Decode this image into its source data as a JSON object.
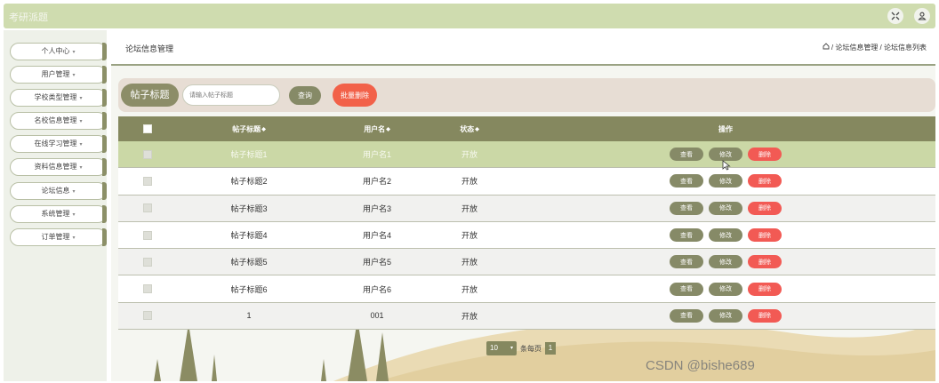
{
  "app": {
    "title": "考研派题",
    "icons": [
      "expand-icon",
      "user-icon"
    ]
  },
  "sidebar": {
    "items": [
      {
        "label": "个人中心"
      },
      {
        "label": "用户管理"
      },
      {
        "label": "学校类型管理"
      },
      {
        "label": "名校信息管理"
      },
      {
        "label": "在线学习管理"
      },
      {
        "label": "资料信息管理"
      },
      {
        "label": "论坛信息"
      },
      {
        "label": "系统管理"
      },
      {
        "label": "订单管理"
      }
    ],
    "arrow": "▾"
  },
  "page": {
    "title": "论坛信息管理",
    "breadcrumb": "/ 论坛信息管理 / 论坛信息列表"
  },
  "search": {
    "label": "帖子标题",
    "placeholder": "请输入帖子标题",
    "value": "",
    "query_btn": "查询",
    "batch_delete_btn": "批量删除"
  },
  "table": {
    "headers": {
      "title": "帖子标题",
      "username": "用户名",
      "status": "状态",
      "ops": "操作",
      "sort": "◆"
    },
    "rows": [
      {
        "title": "帖子标题1",
        "username": "用户名1",
        "status": "开放"
      },
      {
        "title": "帖子标题2",
        "username": "用户名2",
        "status": "开放"
      },
      {
        "title": "帖子标题3",
        "username": "用户名3",
        "status": "开放"
      },
      {
        "title": "帖子标题4",
        "username": "用户名4",
        "status": "开放"
      },
      {
        "title": "帖子标题5",
        "username": "用户名5",
        "status": "开放"
      },
      {
        "title": "帖子标题6",
        "username": "用户名6",
        "status": "开放"
      },
      {
        "title": "1",
        "username": "001",
        "status": "开放"
      }
    ],
    "ops": {
      "view": "查看",
      "edit": "修改",
      "delete": "删除"
    },
    "highlighted_row": 0
  },
  "pager": {
    "page_size": "10",
    "per_page_label": "条每页",
    "current_page": "1"
  },
  "watermark": "CSDN @bishe689",
  "colors": {
    "accent": "#85885f",
    "header_bar": "#cfdcaf",
    "danger": "#f25a54",
    "row_highlight": "#cbd8a6"
  }
}
